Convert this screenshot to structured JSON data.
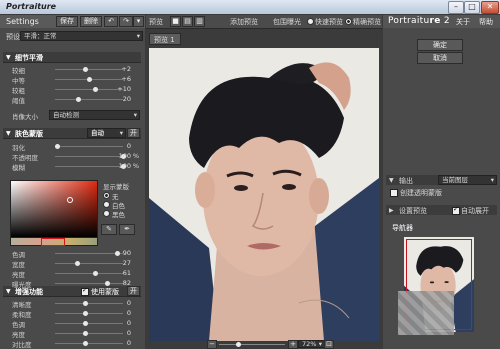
{
  "title": "Portraiture",
  "left": {
    "settings_label": "Settings",
    "save_label": "保存",
    "delete_label": "删除",
    "preset_label": "预设",
    "preset_value": "平滑：正常",
    "sections": {
      "detail": "细节平滑",
      "skin": "肤色蒙版",
      "enhance": "增强功能"
    },
    "detail_sliders": [
      {
        "name": "较细",
        "value": "+2"
      },
      {
        "name": "中等",
        "value": "+6"
      },
      {
        "name": "较粗",
        "value": "+10"
      },
      {
        "name": "阈值",
        "value": "20"
      }
    ],
    "feature_size_label": "肖像大小",
    "feature_size_value": "自动检测",
    "skin_mode": "自动",
    "skin_reset": "开",
    "skin_sliders": [
      {
        "name": "羽化",
        "value": "0",
        "unit": ""
      },
      {
        "name": "不透明度",
        "value": "100",
        "unit": "%"
      },
      {
        "name": "模糊",
        "value": "100",
        "unit": "%"
      }
    ],
    "show_mask_label": "显示蒙版",
    "mask_options": [
      "无",
      "白色",
      "黑色"
    ],
    "color_sliders": [
      {
        "name": "色调",
        "value": "90"
      },
      {
        "name": "宽度",
        "value": "27"
      },
      {
        "name": "亮度",
        "value": "61"
      },
      {
        "name": "曝光度",
        "value": "82"
      }
    ],
    "enhance_use_mask": "使用蒙版",
    "enhance_sliders": [
      {
        "name": "清晰度",
        "value": "0"
      },
      {
        "name": "柔和度",
        "value": "0"
      },
      {
        "name": "色调",
        "value": "0"
      },
      {
        "name": "亮度",
        "value": "0"
      },
      {
        "name": "对比度",
        "value": "0"
      }
    ]
  },
  "center": {
    "preview_label": "预览",
    "add_preview": "添加预览",
    "out_mask": "包围曝光",
    "quick_preview": "快速预览",
    "precise_preview": "精确预览",
    "tab": "预览 1",
    "zoom": "72%"
  },
  "right": {
    "brand_a": "Portraitu",
    "brand_b": "re",
    "version": "2",
    "about": "关于",
    "help": "帮助",
    "ok": "确定",
    "cancel": "取消",
    "output_label": "输出",
    "output_value": "当前图层",
    "transparent_label": "创建透明蒙版",
    "settings_preview": "设置预览",
    "auto_expand": "自动展开",
    "navigator": "导航器"
  },
  "colors": {
    "accent": "#c8141c",
    "panel": "#4a4a4a"
  }
}
